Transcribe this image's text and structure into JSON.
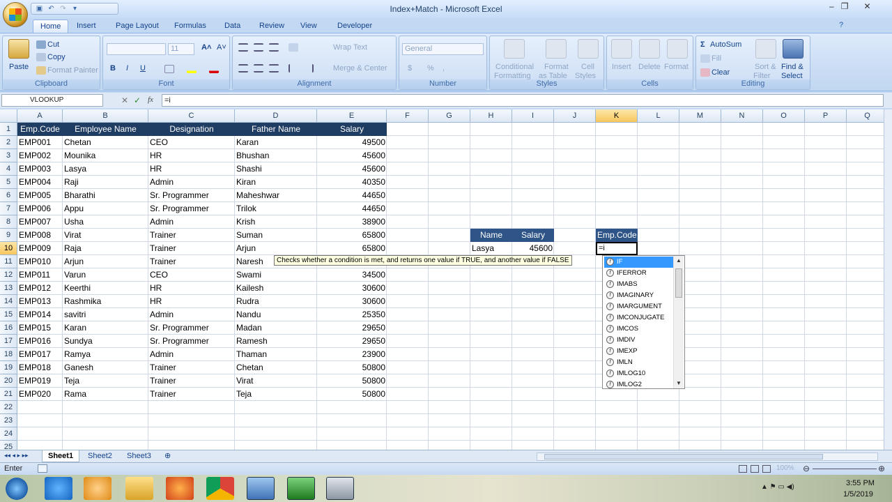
{
  "window": {
    "title": "Index+Match - Microsoft Excel",
    "controls": [
      "–",
      "❐",
      "✕"
    ]
  },
  "ribbon_tabs": [
    "Home",
    "Insert",
    "Page Layout",
    "Formulas",
    "Data",
    "Review",
    "View",
    "Developer"
  ],
  "active_tab": "Home",
  "clipboard": {
    "paste": "Paste",
    "cut": "Cut",
    "copy": "Copy",
    "format_painter": "Format Painter",
    "title": "Clipboard"
  },
  "font": {
    "size": "11",
    "title": "Font",
    "bold": "B",
    "italic": "I",
    "underline": "U"
  },
  "alignment": {
    "wrap": "Wrap Text",
    "merge": "Merge & Center",
    "title": "Alignment"
  },
  "number": {
    "format": "General",
    "title": "Number",
    "currency": "$",
    "percent": "%"
  },
  "styles": {
    "conditional": "Conditional",
    "formatting": "Formatting",
    "format": "Format",
    "as_table": "as Table",
    "cell": "Cell",
    "cell_styles": "Styles",
    "title": "Styles"
  },
  "cells": {
    "insert": "Insert",
    "delete": "Delete",
    "format": "Format",
    "title": "Cells"
  },
  "editing": {
    "autosum": "AutoSum",
    "fill": "Fill",
    "clear": "Clear",
    "sort": "Sort &",
    "filter": "Filter",
    "find": "Find &",
    "select": "Select",
    "title": "Editing"
  },
  "formula_bar": {
    "name_box": "VLOOKUP",
    "formula": "=i",
    "cancel": "✕",
    "enter": "✓",
    "fx": "fx"
  },
  "columns": [
    "A",
    "B",
    "C",
    "D",
    "E",
    "F",
    "G",
    "H",
    "I",
    "J",
    "K",
    "L",
    "M",
    "N",
    "O",
    "P",
    "Q"
  ],
  "selected_column": "K",
  "rows": [
    "1",
    "2",
    "3",
    "4",
    "5",
    "6",
    "7",
    "8",
    "9",
    "10",
    "11",
    "12",
    "13",
    "14",
    "15",
    "16",
    "17",
    "18",
    "19",
    "20",
    "21",
    "22",
    "23",
    "24",
    "25"
  ],
  "selected_row": "10",
  "table_headers": [
    "Emp.Code",
    "Employee Name",
    "Designation",
    "Father Name",
    "Salary"
  ],
  "table_rows": [
    [
      "EMP001",
      "Chetan",
      "CEO",
      "Karan",
      "49500"
    ],
    [
      "EMP002",
      "Mounika",
      "HR",
      "Bhushan",
      "45600"
    ],
    [
      "EMP003",
      "Lasya",
      "HR",
      "Shashi",
      "45600"
    ],
    [
      "EMP004",
      "Raji",
      "Admin",
      "Kiran",
      "40350"
    ],
    [
      "EMP005",
      "Bharathi",
      "Sr. Programmer",
      "Maheshwar",
      "44650"
    ],
    [
      "EMP006",
      "Appu",
      "Sr. Programmer",
      "Trilok",
      "44650"
    ],
    [
      "EMP007",
      "Usha",
      "Admin",
      "Krish",
      "38900"
    ],
    [
      "EMP008",
      "Virat",
      "Trainer",
      "Suman",
      "65800"
    ],
    [
      "EMP009",
      "Raja",
      "Trainer",
      "Arjun",
      "65800"
    ],
    [
      "EMP010",
      "Arjun",
      "Trainer",
      "Naresh",
      ""
    ],
    [
      "EMP011",
      "Varun",
      "CEO",
      "Swami",
      "34500"
    ],
    [
      "EMP012",
      "Keerthi",
      "HR",
      "Kailesh",
      "30600"
    ],
    [
      "EMP013",
      "Rashmika",
      "HR",
      "Rudra",
      "30600"
    ],
    [
      "EMP014",
      "savitri",
      "Admin",
      "Nandu",
      "25350"
    ],
    [
      "EMP015",
      "Karan",
      "Sr. Programmer",
      "Madan",
      "29650"
    ],
    [
      "EMP016",
      "Sundya",
      "Sr. Programmer",
      "Ramesh",
      "29650"
    ],
    [
      "EMP017",
      "Ramya",
      "Admin",
      "Thaman",
      "23900"
    ],
    [
      "EMP018",
      "Ganesh",
      "Trainer",
      "Chetan",
      "50800"
    ],
    [
      "EMP019",
      "Teja",
      "Trainer",
      "Virat",
      "50800"
    ],
    [
      "EMP020",
      "Rama",
      "Trainer",
      "Teja",
      "50800"
    ]
  ],
  "lookup": {
    "name_header": "Name",
    "salary_header": "Salary",
    "name_value": "Lasya",
    "salary_value": "45600",
    "code_header": "Emp.Code",
    "code_input": "=i"
  },
  "tooltip": "Checks whether a condition is met, and returns one value if TRUE, and another value if FALSE",
  "autocomplete": [
    "IF",
    "IFERROR",
    "IMABS",
    "IMAGINARY",
    "IMARGUMENT",
    "IMCONJUGATE",
    "IMCOS",
    "IMDIV",
    "IMEXP",
    "IMLN",
    "IMLOG10",
    "IMLOG2"
  ],
  "autocomplete_selected": 0,
  "sheets": [
    "Sheet1",
    "Sheet2",
    "Sheet3"
  ],
  "active_sheet": "Sheet1",
  "status": {
    "mode": "Enter",
    "zoom": "100%"
  },
  "clock": {
    "time": "3:55 PM",
    "date": "1/5/2019"
  }
}
